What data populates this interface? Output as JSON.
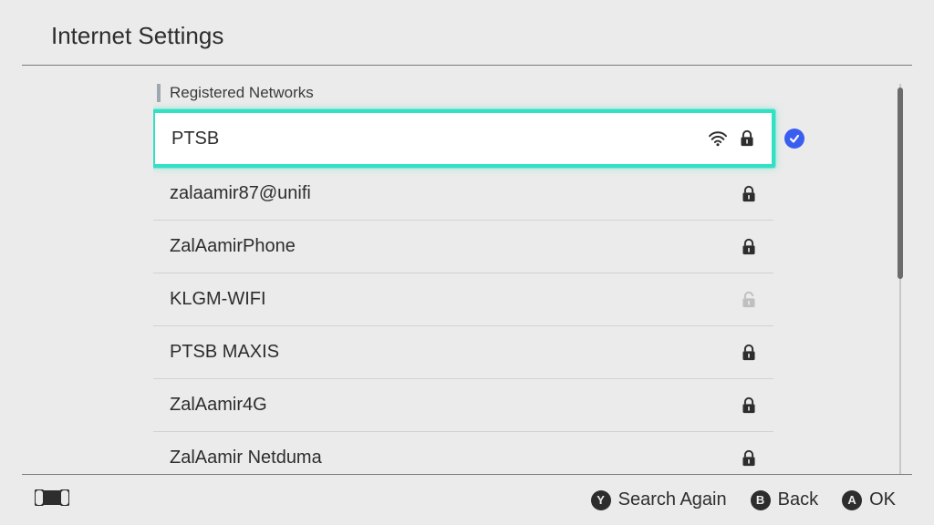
{
  "header": {
    "title": "Internet Settings"
  },
  "section": {
    "registered_label": "Registered Networks"
  },
  "networks": [
    {
      "name": "PTSB",
      "locked": true,
      "signal": true,
      "selected": true,
      "connected": true
    },
    {
      "name": "zalaamir87@unifi",
      "locked": true,
      "signal": false,
      "selected": false,
      "connected": false
    },
    {
      "name": "ZalAamirPhone",
      "locked": true,
      "signal": false,
      "selected": false,
      "connected": false
    },
    {
      "name": "KLGM-WIFI",
      "locked": false,
      "signal": false,
      "selected": false,
      "connected": false
    },
    {
      "name": "PTSB MAXIS",
      "locked": true,
      "signal": false,
      "selected": false,
      "connected": false
    },
    {
      "name": "ZalAamir4G",
      "locked": true,
      "signal": false,
      "selected": false,
      "connected": false
    },
    {
      "name": "ZalAamir Netduma",
      "locked": true,
      "signal": false,
      "selected": false,
      "connected": false
    }
  ],
  "footer": {
    "search_again_label": "Search Again",
    "back_label": "Back",
    "ok_label": "OK",
    "y_glyph": "Y",
    "b_glyph": "B",
    "a_glyph": "A"
  }
}
